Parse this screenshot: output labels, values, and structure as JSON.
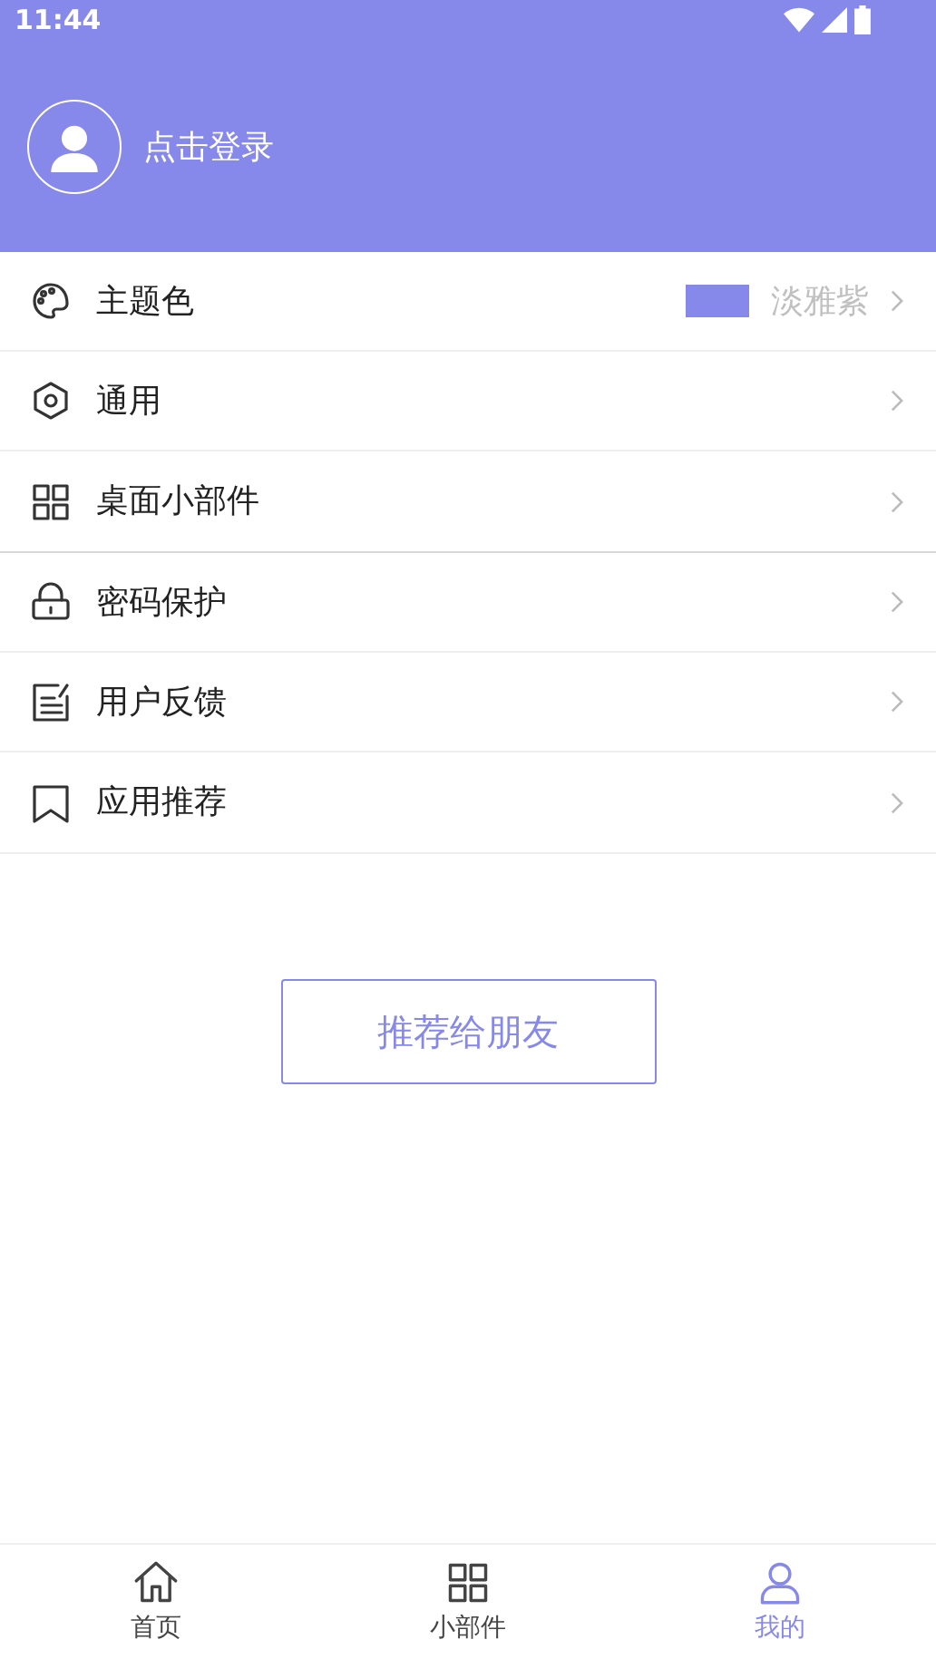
{
  "status_bar": {
    "time": "11:44"
  },
  "profile": {
    "login_label": "点击登录"
  },
  "sections": [
    {
      "items": [
        {
          "kind": "palette",
          "label": "主题色",
          "color": "#8789ea",
          "value": "淡雅紫"
        },
        {
          "kind": "hexagon",
          "label": "通用"
        },
        {
          "kind": "grid",
          "label": "桌面小部件"
        }
      ]
    },
    {
      "items": [
        {
          "kind": "lock",
          "label": "密码保护"
        },
        {
          "kind": "note",
          "label": "用户反馈"
        },
        {
          "kind": "bookmark",
          "label": "应用推荐"
        }
      ]
    }
  ],
  "share_button": "推荐给朋友",
  "bottom_nav": [
    {
      "kind": "home",
      "label": "首页",
      "selected": false
    },
    {
      "kind": "grid",
      "label": "小部件",
      "selected": false
    },
    {
      "kind": "person",
      "label": "我的",
      "selected": true
    }
  ]
}
